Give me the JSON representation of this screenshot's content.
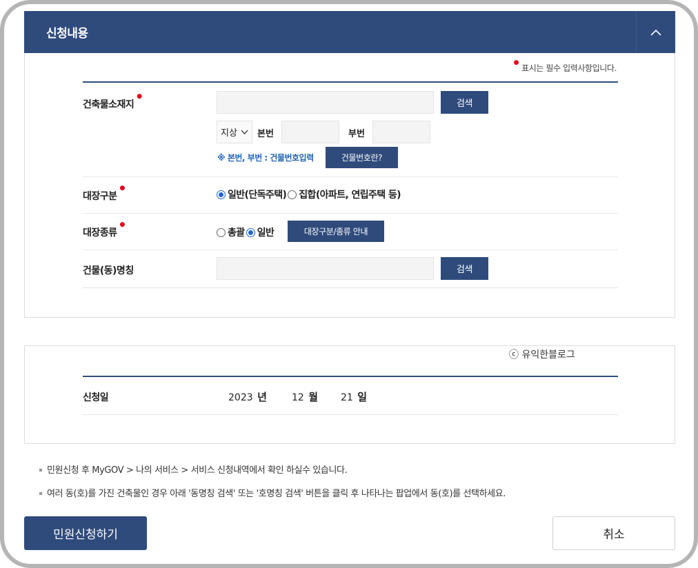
{
  "header": {
    "title": "신청내용",
    "toggle_icon": "chevron-up-icon"
  },
  "required_note": "표시는 필수 입력사항입니다.",
  "address": {
    "label": "건축물소재지",
    "search_label": "검색",
    "select_value": "지상",
    "main_no_label": "본번",
    "sub_no_label": "부번",
    "hint": "※ 본번, 부번 : 건물번호입력",
    "help_button": "건물번호란?"
  },
  "register_type": {
    "label": "대장구분",
    "options": [
      "일반(단독주택)",
      "집합(아파트, 연립주택 등)"
    ],
    "selected": 0
  },
  "register_kind": {
    "label": "대장종류",
    "options": [
      "총괄",
      "일반"
    ],
    "selected": 1,
    "guide_button": "대장구분/종류 안내"
  },
  "building_name": {
    "label": "건물(동)명칭",
    "search_label": "검색"
  },
  "watermark": "ⓒ 유익한블로그",
  "date": {
    "label": "신청일",
    "year": "2023",
    "year_unit": "년",
    "month": "12",
    "month_unit": "월",
    "day": "21",
    "day_unit": "일"
  },
  "notes": [
    "민원신청 후 MyGOV > 나의 서비스 > 서비스 신청내역에서 확인 하실수 있습니다.",
    "여러 동(호)를 가진 건축물인 경우 아래 '동명칭 검색' 또는 '호명칭 검색' 버튼을 클릭 후 나타나는 팝업에서 동(호)를 선택하세요."
  ],
  "actions": {
    "submit": "민원신청하기",
    "cancel": "취소"
  }
}
